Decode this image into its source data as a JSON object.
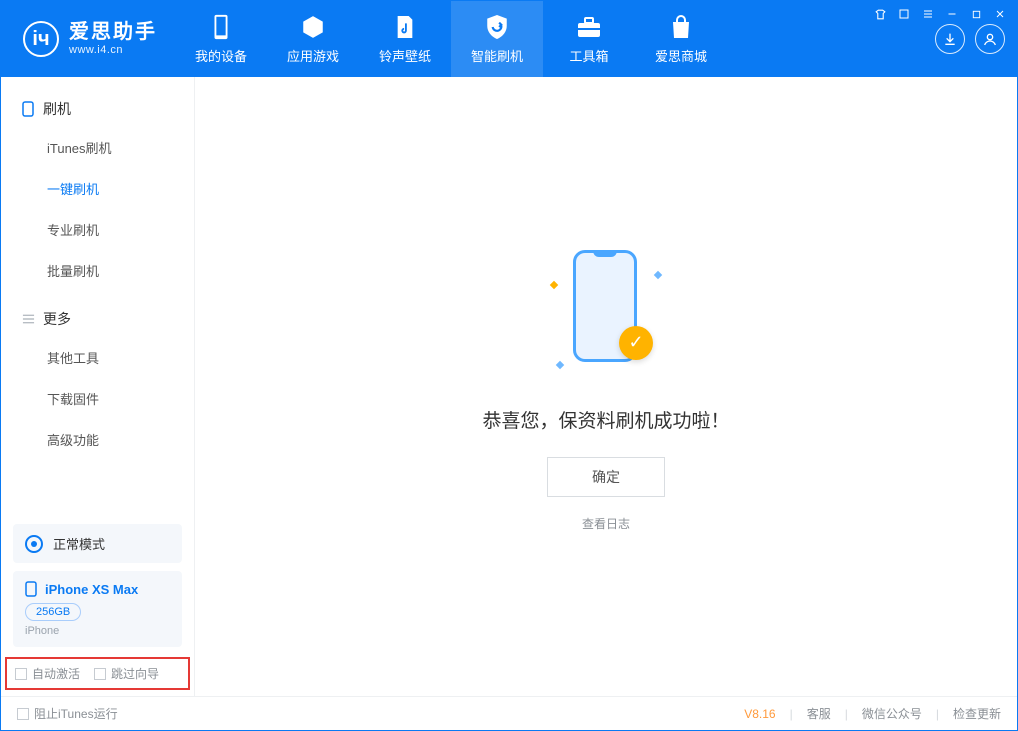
{
  "app": {
    "title": "爱思助手",
    "site": "www.i4.cn"
  },
  "nav": {
    "items": [
      {
        "label": "我的设备"
      },
      {
        "label": "应用游戏"
      },
      {
        "label": "铃声壁纸"
      },
      {
        "label": "智能刷机"
      },
      {
        "label": "工具箱"
      },
      {
        "label": "爱思商城"
      }
    ]
  },
  "sidebar": {
    "section1": {
      "title": "刷机",
      "items": [
        "iTunes刷机",
        "一键刷机",
        "专业刷机",
        "批量刷机"
      ]
    },
    "section2": {
      "title": "更多",
      "items": [
        "其他工具",
        "下载固件",
        "高级功能"
      ]
    },
    "status": {
      "label": "正常模式"
    },
    "device": {
      "name": "iPhone XS Max",
      "storage": "256GB",
      "type": "iPhone"
    },
    "options": {
      "auto_activate": "自动激活",
      "skip_guide": "跳过向导"
    }
  },
  "main": {
    "success_text": "恭喜您，保资料刷机成功啦！",
    "ok_button": "确定",
    "view_log": "查看日志"
  },
  "footer": {
    "block_itunes": "阻止iTunes运行",
    "version": "V8.16",
    "support": "客服",
    "wechat": "微信公众号",
    "update": "检查更新"
  }
}
